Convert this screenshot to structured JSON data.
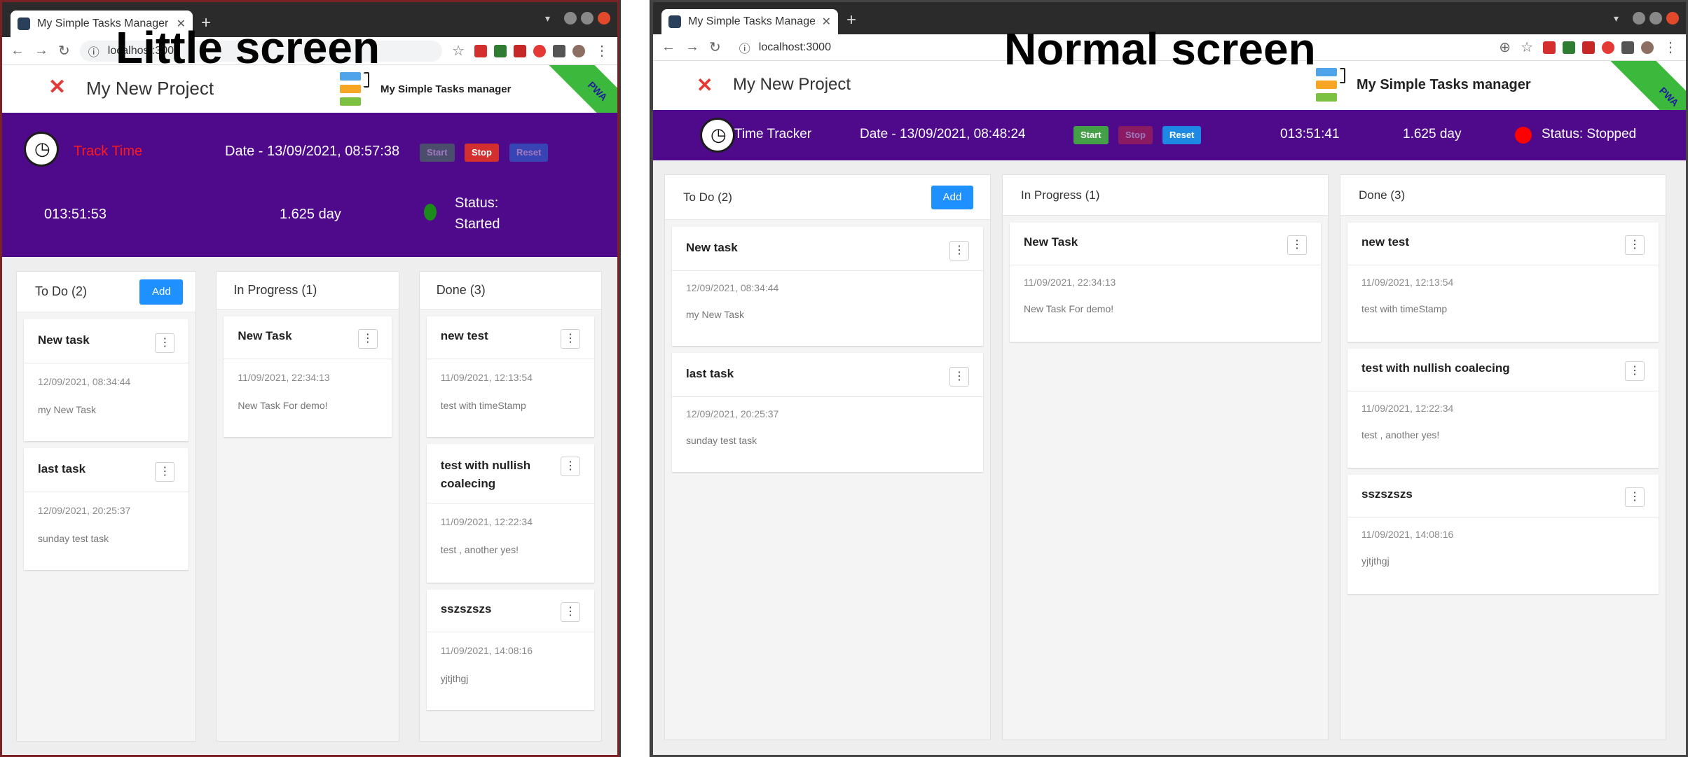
{
  "labels": {
    "little": "Little screen",
    "normal": "Normal screen"
  },
  "browser": {
    "tab_title": "My Simple Tasks Manager",
    "url_left": "localhost:300",
    "url_right": "localhost:3000"
  },
  "app": {
    "project_name": "My New Project",
    "brand": "My Simple Tasks manager",
    "pwa_label": "PWA"
  },
  "tracker_little": {
    "title": "Track Time",
    "date": "Date - 13/09/2021, 08:57:38",
    "start": "Start",
    "stop": "Stop",
    "reset": "Reset",
    "elapsed": "013:51:53",
    "days": "1.625 day",
    "status_line1": "Status:",
    "status_line2": "Started"
  },
  "tracker_normal": {
    "title": "Time Tracker",
    "date": "Date - 13/09/2021, 08:48:24",
    "start": "Start",
    "stop": "Stop",
    "reset": "Reset",
    "elapsed": "013:51:41",
    "days": "1.625 day",
    "status": "Status: Stopped"
  },
  "columns": {
    "todo": {
      "title": "To Do (2)",
      "add": "Add"
    },
    "inprogress": {
      "title": "In Progress (1)"
    },
    "done": {
      "title": "Done (3)"
    }
  },
  "cards": {
    "todo": [
      {
        "title": "New task",
        "date": "12/09/2021, 08:34:44",
        "desc": "my New Task"
      },
      {
        "title": "last task",
        "date": "12/09/2021, 20:25:37",
        "desc": "sunday test task"
      }
    ],
    "inprogress": [
      {
        "title": "New Task",
        "date": "11/09/2021, 22:34:13",
        "desc": "New Task For demo!"
      }
    ],
    "done": [
      {
        "title": "new test",
        "date": "11/09/2021, 12:13:54",
        "desc": "test with timeStamp"
      },
      {
        "title": "test with nullish coalecing",
        "date": "11/09/2021, 12:22:34",
        "desc": "test , another yes!"
      },
      {
        "title": "sszszszs",
        "date": "11/09/2021, 14:08:16",
        "desc": "yjtjthgj"
      }
    ]
  },
  "colors": {
    "tracker_bg": "#4f0a8c",
    "accent_blue": "#1e90ff",
    "started_dot": "#1b8a1b",
    "stopped_dot": "#ff0000",
    "track_time_text": "#ff1a1a"
  }
}
